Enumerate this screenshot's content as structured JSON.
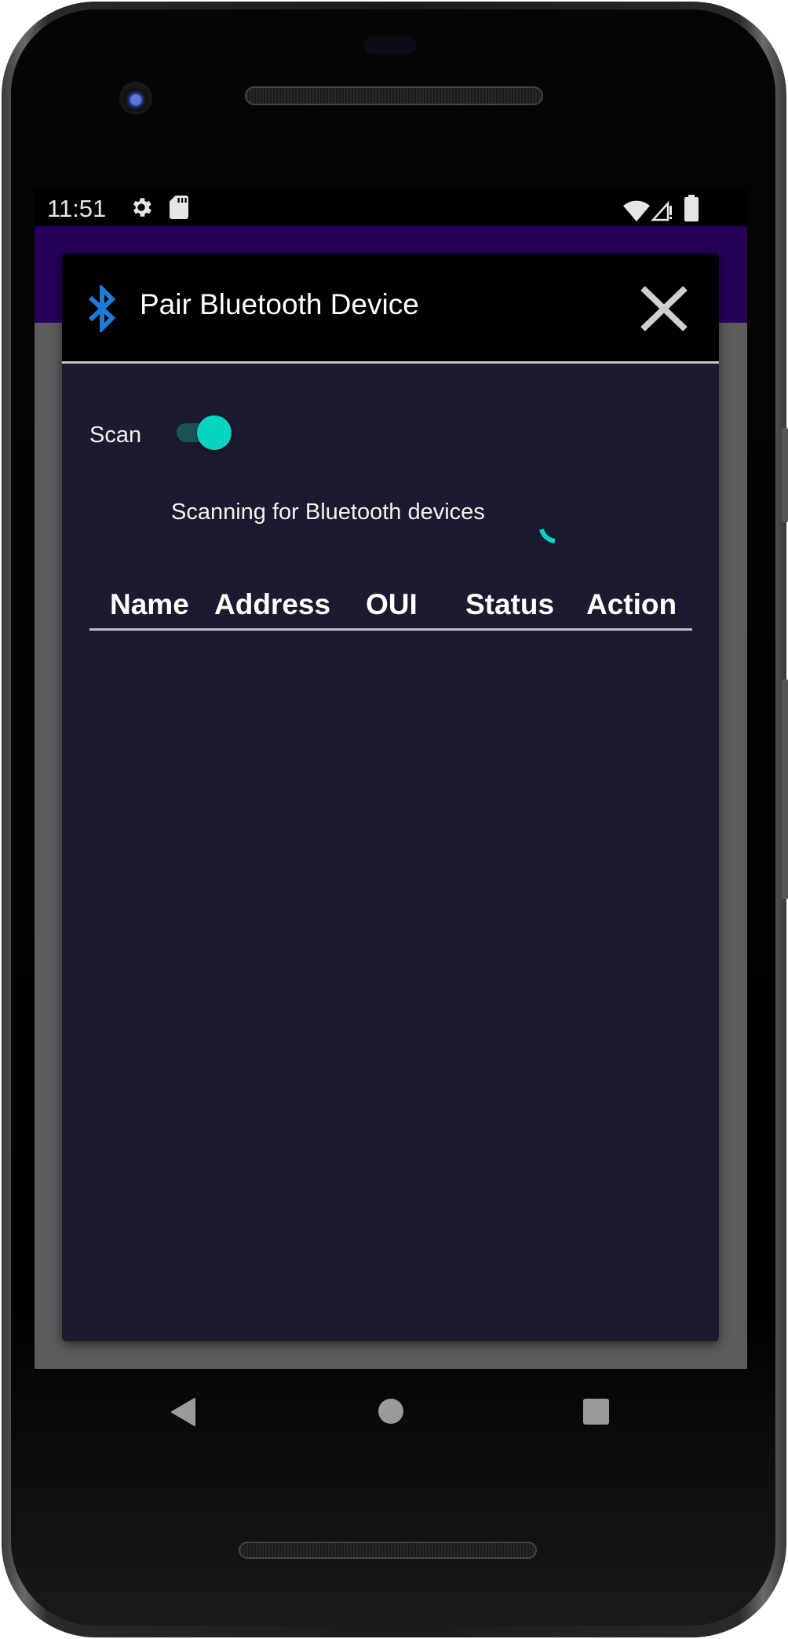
{
  "status_bar": {
    "time": "11:51",
    "left_icons": [
      "gear-icon",
      "sd-card-icon"
    ],
    "right_icons": [
      "wifi-icon",
      "cell-signal-no-data-icon",
      "battery-icon"
    ]
  },
  "dialog": {
    "title": "Pair Bluetooth Device",
    "title_icon": "bluetooth-icon",
    "close_icon": "close-icon",
    "scan": {
      "label": "Scan",
      "enabled": true
    },
    "scan_status": "Scanning for Bluetooth devices",
    "table": {
      "columns": [
        "Name",
        "Address",
        "OUI",
        "Status",
        "Action"
      ],
      "rows": []
    }
  },
  "nav_bar": {
    "buttons": [
      "back",
      "home",
      "recents"
    ]
  },
  "colors": {
    "app_bar": "#250059",
    "dialog_background": "#1b1a2e",
    "accent": "#06d6c0",
    "bluetooth_blue": "#1e7ad6"
  }
}
